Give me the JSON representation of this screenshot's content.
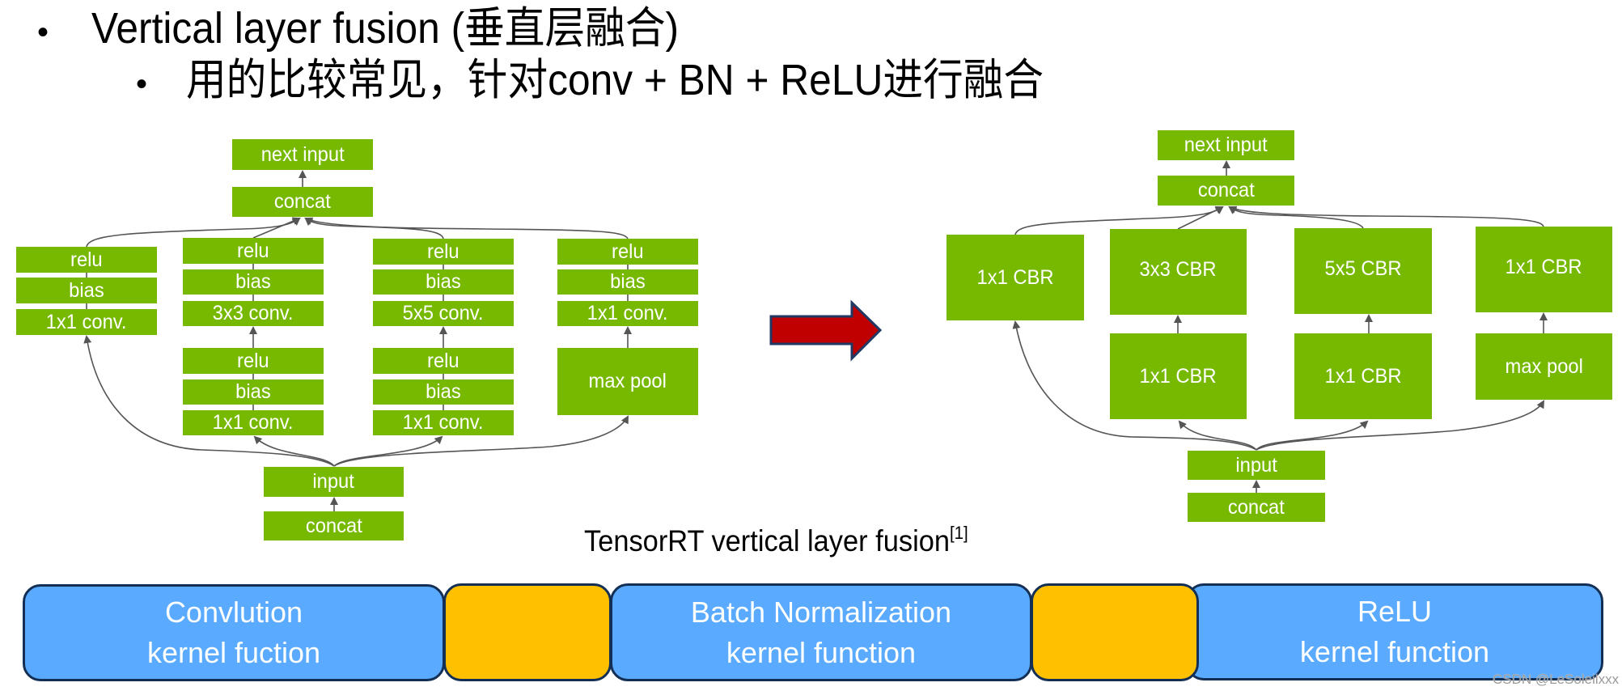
{
  "slide": {
    "title": "Vertical layer fusion (垂直层融合)",
    "subtitle": "用的比较常见，针对conv + BN + ReLU进行融合",
    "bullet_glyph": "•"
  },
  "colors": {
    "node_green": "#76b900",
    "arrow_red": "#c00000",
    "arrow_border": "#1f3864",
    "kernel_blue": "#5aabff",
    "kernel_gap_yellow": "#ffc000",
    "edge_gray": "#555555"
  },
  "left_diagram": {
    "next_input": "next input",
    "concat_top": "concat",
    "branch1": [
      "relu",
      "bias",
      "1x1 conv."
    ],
    "branch2_upper": [
      "relu",
      "bias",
      "3x3 conv."
    ],
    "branch2_lower": [
      "relu",
      "bias",
      "1x1 conv."
    ],
    "branch3_upper": [
      "relu",
      "bias",
      "5x5 conv."
    ],
    "branch3_lower": [
      "relu",
      "bias",
      "1x1 conv."
    ],
    "branch4_upper": [
      "relu",
      "bias",
      "1x1 conv."
    ],
    "branch4_lower": "max pool",
    "input": "input",
    "concat_bottom": "concat"
  },
  "transform_arrow": "right-arrow-icon",
  "right_diagram": {
    "next_input": "next input",
    "concat_top": "concat",
    "branch1": "1x1 CBR",
    "branch2_upper": "3x3 CBR",
    "branch2_lower": "1x1 CBR",
    "branch3_upper": "5x5 CBR",
    "branch3_lower": "1x1 CBR",
    "branch4_upper": "1x1 CBR",
    "branch4_lower": "max pool",
    "input": "input",
    "concat_bottom": "concat"
  },
  "caption": {
    "text": "TensorRT vertical layer fusion",
    "reference": "[1]"
  },
  "kernel_bar": {
    "convolution": [
      "Convlution",
      "kernel fuction"
    ],
    "batch_norm": [
      "Batch Normalization",
      "kernel function"
    ],
    "relu": [
      "ReLU",
      "kernel function"
    ]
  },
  "watermark": "CSDN @LeSoleilxxx"
}
